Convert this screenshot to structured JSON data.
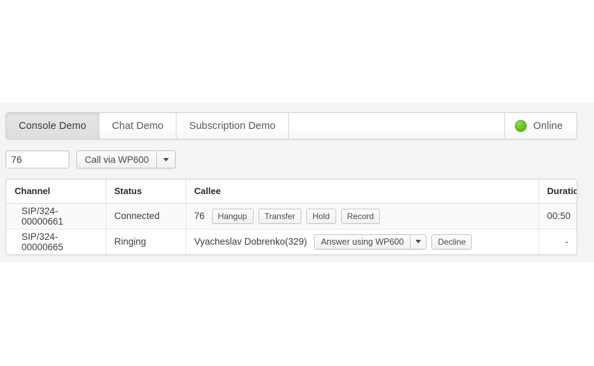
{
  "panel": {
    "tabs": [
      {
        "label": "Console Demo",
        "active": true
      },
      {
        "label": "Chat Demo",
        "active": false
      },
      {
        "label": "Subscription Demo",
        "active": false
      }
    ],
    "status": {
      "label": "Online",
      "indicator_icon": "status-dot-icon",
      "color": "#66c821"
    }
  },
  "call_form": {
    "destination_value": "76",
    "destination_placeholder": "",
    "call_button_label": "Call via WP600",
    "caret_icon": "chevron-down-icon"
  },
  "calls_table": {
    "columns": [
      "Channel",
      "Status",
      "Callee",
      "Duration"
    ],
    "rows": [
      {
        "channel": "SIP/324-00000661",
        "status": "Connected",
        "callee": "76",
        "duration": "00:50",
        "actions": [
          {
            "type": "button",
            "label": "Hangup"
          },
          {
            "type": "button",
            "label": "Transfer"
          },
          {
            "type": "button",
            "label": "Hold"
          },
          {
            "type": "button",
            "label": "Record"
          }
        ]
      },
      {
        "channel": "SIP/324-00000665",
        "status": "Ringing",
        "callee": "Vyacheslav Dobrenko(329)",
        "duration": "-",
        "actions": [
          {
            "type": "split",
            "label": "Answer using WP600"
          },
          {
            "type": "button",
            "label": "Decline"
          }
        ]
      }
    ]
  }
}
